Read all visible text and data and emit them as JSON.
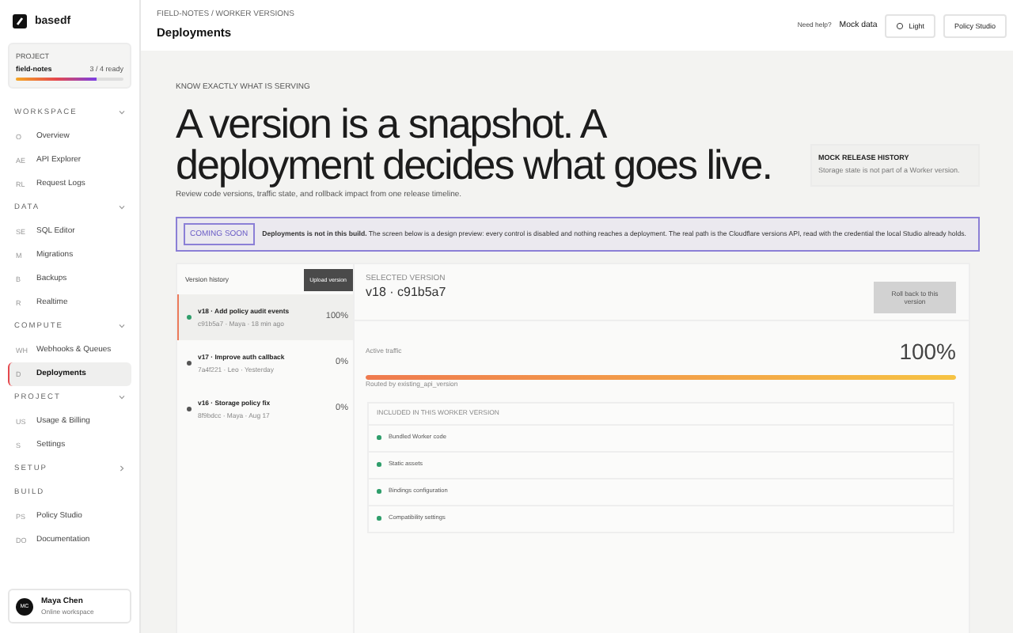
{
  "brand": {
    "name": "basedf"
  },
  "project": {
    "label": "PROJECT",
    "name": "field-notes",
    "status": "3 / 4 ready",
    "level": 0.75
  },
  "nav": [
    {
      "title": "WORKSPACE",
      "expanded": true,
      "items": [
        {
          "code": "O",
          "label": "Overview",
          "selected": false
        },
        {
          "code": "AE",
          "label": "API Explorer",
          "selected": false
        },
        {
          "code": "RL",
          "label": "Request Logs",
          "selected": false
        }
      ]
    },
    {
      "title": "DATA",
      "expanded": true,
      "items": [
        {
          "code": "SE",
          "label": "SQL Editor",
          "selected": false
        },
        {
          "code": "M",
          "label": "Migrations",
          "selected": false
        },
        {
          "code": "B",
          "label": "Backups",
          "selected": false
        },
        {
          "code": "R",
          "label": "Realtime",
          "selected": false
        }
      ]
    },
    {
      "title": "COMPUTE",
      "expanded": true,
      "items": [
        {
          "code": "WH",
          "label": "Webhooks & Queues",
          "selected": false
        },
        {
          "code": "D",
          "label": "Deployments",
          "selected": true
        }
      ]
    },
    {
      "title": "PROJECT",
      "expanded": true,
      "items": [
        {
          "code": "US",
          "label": "Usage & Billing",
          "selected": false
        },
        {
          "code": "S",
          "label": "Settings",
          "selected": false
        }
      ]
    },
    {
      "title": "SETUP",
      "expanded": false
    },
    {
      "title": "BUILD",
      "items": [
        {
          "code": "PS",
          "label": "Policy Studio",
          "selected": false
        },
        {
          "code": "DO",
          "label": "Documentation",
          "selected": false
        }
      ]
    }
  ],
  "user": {
    "initials": "MC",
    "name": "Maya Chen",
    "role": "Online workspace"
  },
  "header": {
    "breadcrumb": "FIELD-NOTES / WORKER VERSIONS",
    "title": "Deployments",
    "help": "Need help?",
    "mock": "Mock data",
    "theme": "Light",
    "studio": "Policy Studio"
  },
  "hero": {
    "eyebrow": "KNOW EXACTLY WHAT IS SERVING",
    "headline": "A version is a snapshot. A deployment decides what goes live.",
    "subtitle": "Review code versions, traffic state, and rollback impact from one release timeline.",
    "note_title": "MOCK RELEASE HISTORY",
    "note_text": "Storage state is not part of a Worker version."
  },
  "banner": {
    "badge": "COMING SOON",
    "text": "**Deployments is not in this build.** The screen below is a design preview: every control is disabled and nothing reaches a deployment. The real path is the Cloudflare versions API, read with the credential the local Studio already holds."
  },
  "history": {
    "title": "Version history",
    "upload": "Upload version",
    "versions": [
      {
        "title": "v18 · Add policy audit events",
        "meta": "c91b5a7 · Maya · 18 min ago",
        "share": "100%",
        "selected": true,
        "live": true
      },
      {
        "title": "v17 · Improve auth callback",
        "meta": "7a4f221 · Leo · Yesterday",
        "share": "0%",
        "selected": false,
        "live": false
      },
      {
        "title": "v16 · Storage policy fix",
        "meta": "8f9bdcc · Maya · Aug 17",
        "share": "0%",
        "selected": false,
        "live": false
      }
    ]
  },
  "detail": {
    "label": "SELECTED VERSION",
    "version": "v18 · c91b5a7",
    "rollback": "Roll back to this version",
    "rollback_disabled": true,
    "traffic": "100%",
    "traffic_label": "Active traffic",
    "level": 1,
    "routing": "Routed by existing_api_version",
    "included_title": "INCLUDED IN THIS WORKER VERSION",
    "included": [
      "Bundled Worker code",
      "Static assets",
      "Bindings configuration",
      "Compatibility settings"
    ]
  }
}
